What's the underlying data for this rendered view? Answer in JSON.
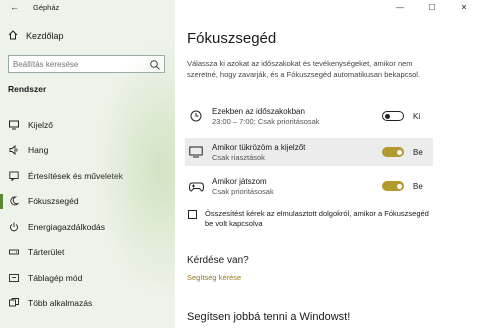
{
  "window": {
    "title": "Gépház"
  },
  "sidebar": {
    "home_label": "Kezdőlap",
    "search_placeholder": "Beállítás keresése",
    "section_title": "Rendszer",
    "items": [
      {
        "label": "Kijelző",
        "icon": "monitor-icon"
      },
      {
        "label": "Hang",
        "icon": "speaker-icon"
      },
      {
        "label": "Értesítések és műveletek",
        "icon": "notification-icon"
      },
      {
        "label": "Fókuszsegéd",
        "icon": "moon-icon",
        "active": true
      },
      {
        "label": "Energiagazdálkodás",
        "icon": "power-icon"
      },
      {
        "label": "Tárterület",
        "icon": "storage-icon"
      },
      {
        "label": "Táblagép mód",
        "icon": "tablet-icon"
      },
      {
        "label": "Több alkalmazás",
        "icon": "multitask-icon"
      }
    ]
  },
  "main": {
    "title": "Fókuszsegéd",
    "description": "Válassza ki azokat az időszakokat és tevékenységeket, amikor nem szeretné, hogy zavarják, és a Fókuszsegéd automatikusan bekapcsol.",
    "rules": [
      {
        "title": "Ezekben az időszakokban",
        "subtitle": "23:00 – 7:00; Csak prioritásosak",
        "state": "Ki",
        "on": false,
        "icon": "clock-icon"
      },
      {
        "title": "Amikor tükrözöm a kijelzőt",
        "subtitle": "Csak riasztások",
        "state": "Be",
        "on": true,
        "icon": "monitor-icon"
      },
      {
        "title": "Amikor játszom",
        "subtitle": "Csak prioritásosak",
        "state": "Be",
        "on": true,
        "icon": "gamepad-icon"
      }
    ],
    "checkbox_label": "Összesítést kérek az elmulasztott dolgokról, amikor a Fókuszsegéd be volt kapcsolva",
    "question_heading": "Kérdése van?",
    "help_link": "Segítség kérése",
    "feedback_heading": "Segítsen jobbá tenni a Windowst!"
  },
  "colors": {
    "accent": "#b39a2e",
    "link": "#9a7a1a",
    "sidebar_bg": "#eef3ea"
  }
}
